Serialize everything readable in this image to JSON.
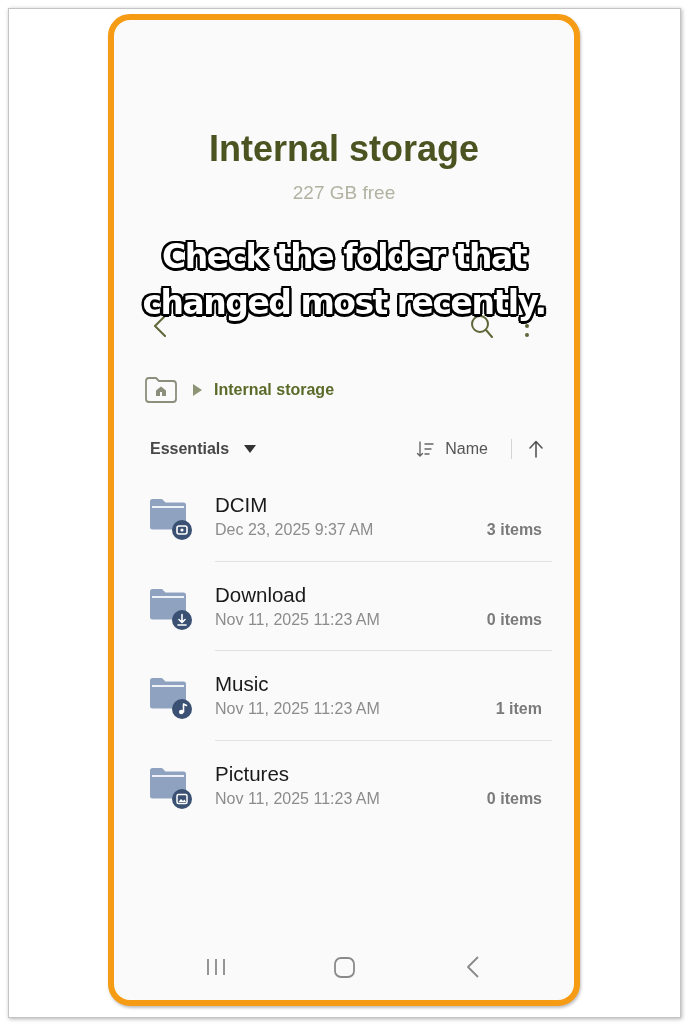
{
  "header": {
    "title": "Internal storage",
    "free_space": "227 GB free"
  },
  "caption": "Check the folder that changed most recently.",
  "breadcrumb": [
    {
      "label": "Internal storage"
    }
  ],
  "list_header": {
    "filter": "Essentials",
    "sort_by": "Name"
  },
  "folders": [
    {
      "kind": "camera",
      "name": "DCIM",
      "modified": "Dec 23, 2025 9:37 AM",
      "count": "3 items"
    },
    {
      "kind": "download",
      "name": "Download",
      "modified": "Nov 11, 2025 11:23 AM",
      "count": "0 items"
    },
    {
      "kind": "music",
      "name": "Music",
      "modified": "Nov 11, 2025 11:23 AM",
      "count": "1 item"
    },
    {
      "kind": "image",
      "name": "Pictures",
      "modified": "Nov 11, 2025 11:23 AM",
      "count": "0 items"
    }
  ]
}
